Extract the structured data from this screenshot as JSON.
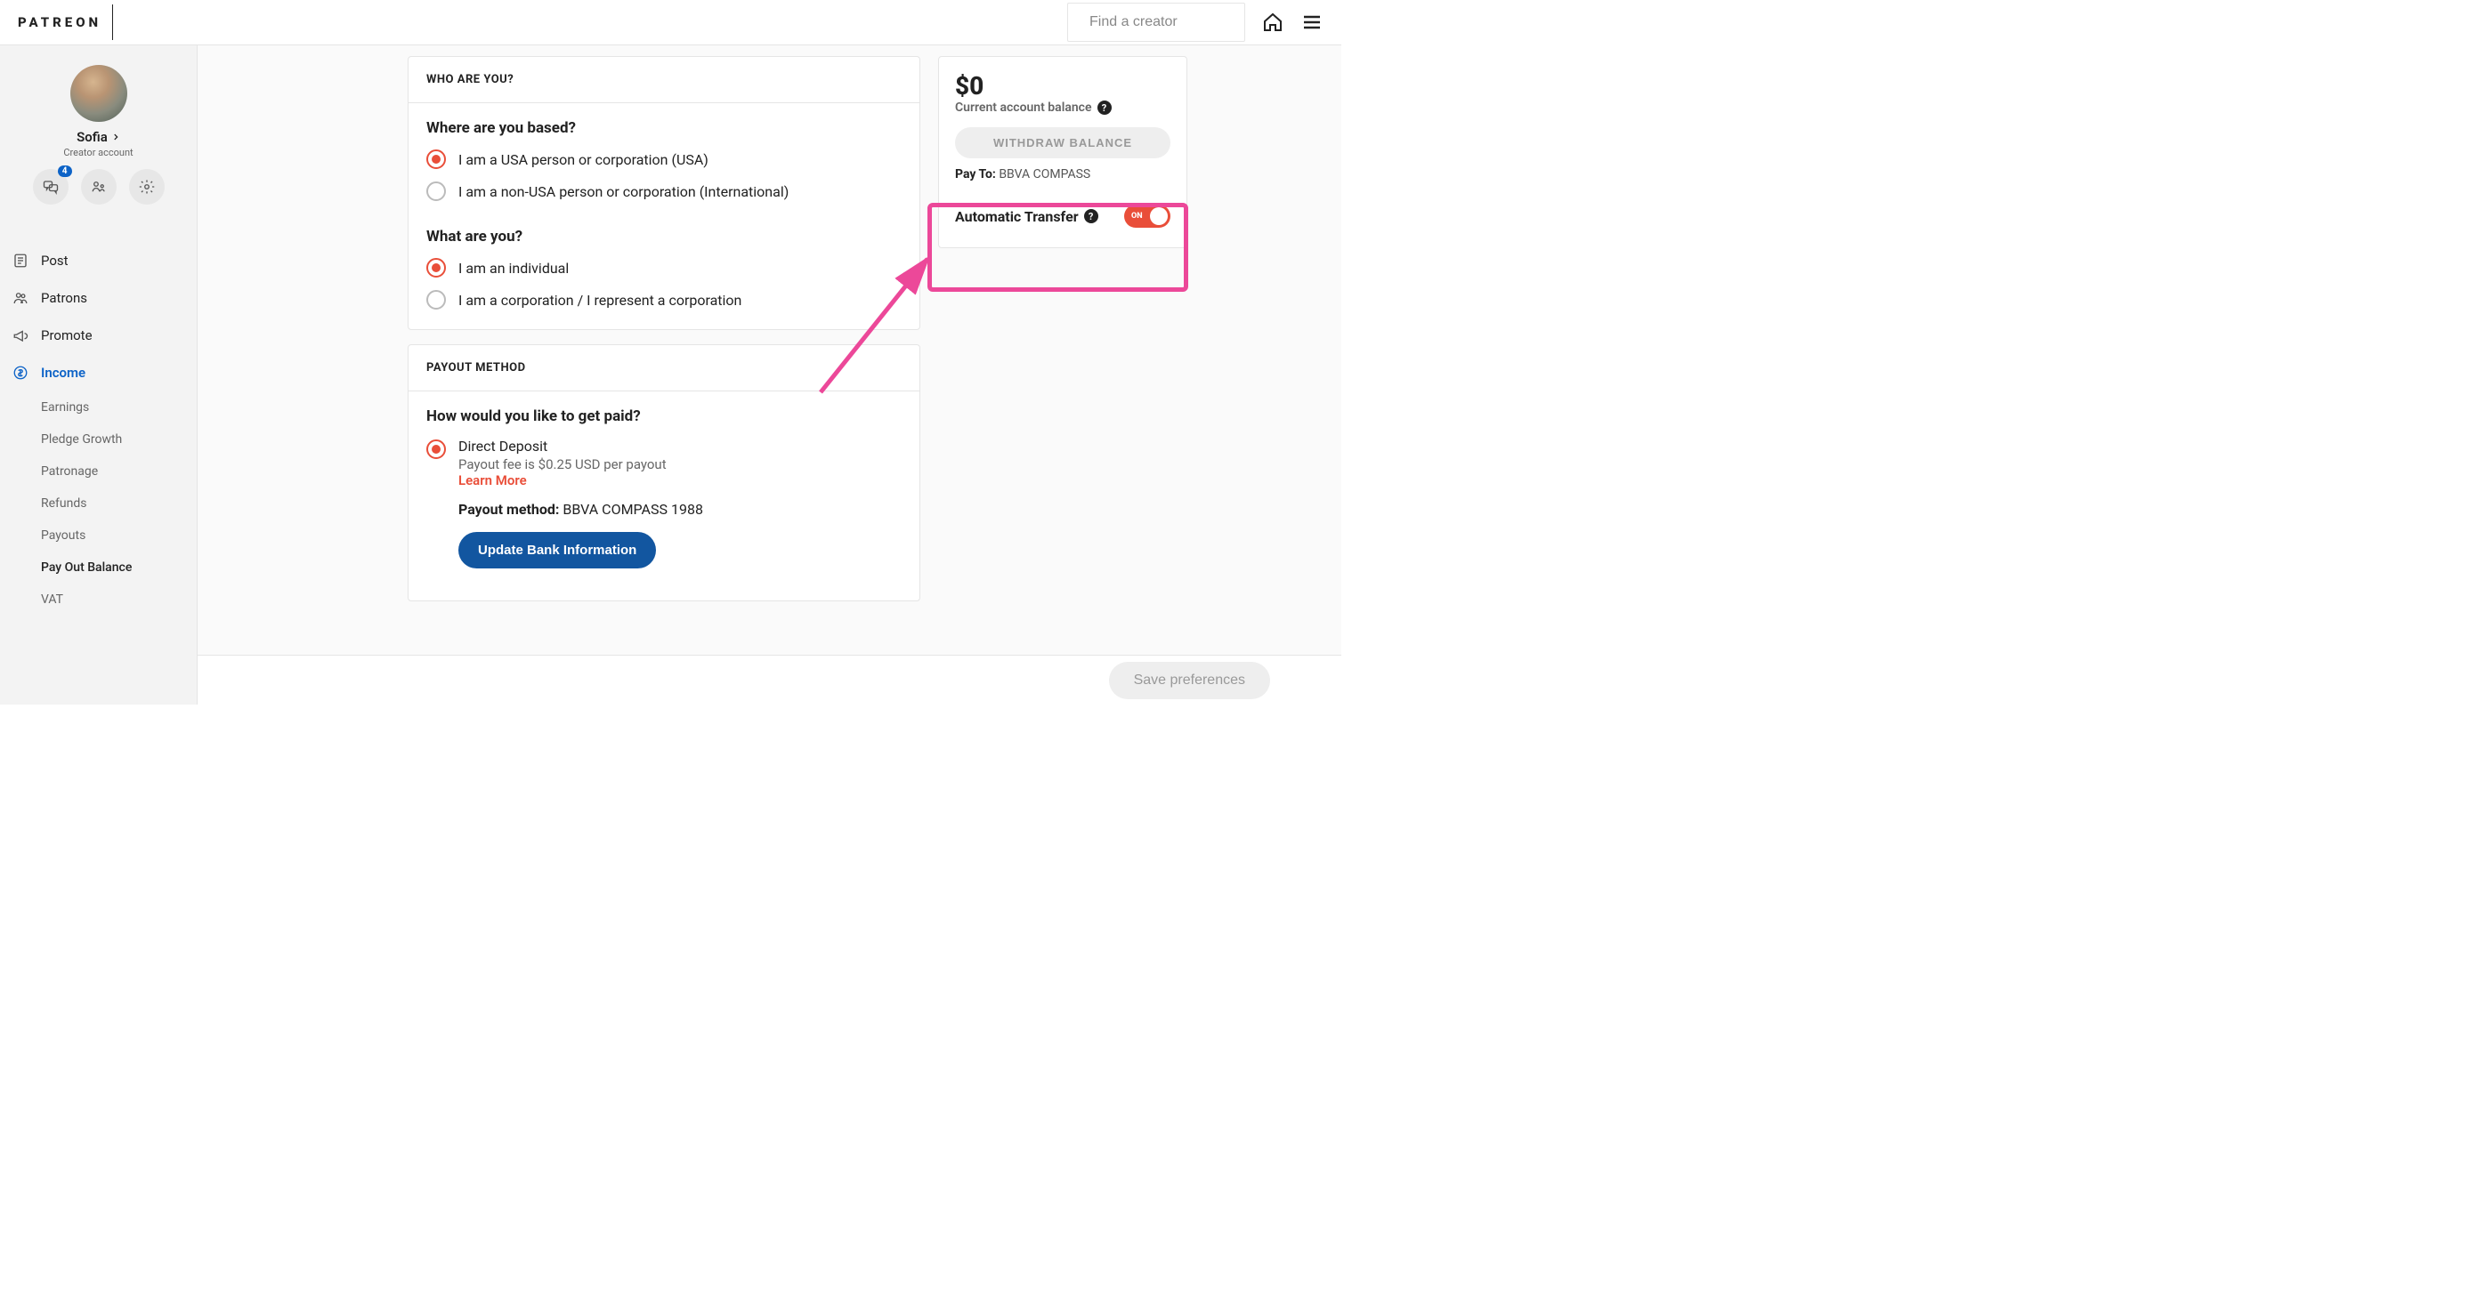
{
  "brand": "PATREON",
  "search": {
    "placeholder": "Find a creator"
  },
  "profile": {
    "name": "Sofia",
    "subtitle": "Creator account",
    "badge_count": "4"
  },
  "nav": {
    "post": "Post",
    "patrons": "Patrons",
    "promote": "Promote",
    "income": "Income"
  },
  "subnav": {
    "earnings": "Earnings",
    "pledge_growth": "Pledge Growth",
    "patronage": "Patronage",
    "refunds": "Refunds",
    "payouts": "Payouts",
    "pay_out_balance": "Pay Out Balance",
    "vat": "VAT"
  },
  "who_card": {
    "title": "WHO ARE YOU?",
    "q1": "Where are you based?",
    "opt1a": "I am a USA person or corporation (USA)",
    "opt1b": "I am a non-USA person or corporation (International)",
    "q2": "What are you?",
    "opt2a": "I am an individual",
    "opt2b": "I am a corporation / I represent a corporation"
  },
  "payout_card": {
    "title": "PAYOUT METHOD",
    "q": "How would you like to get paid?",
    "opt_label": "Direct Deposit",
    "opt_sub": "Payout fee is $0.25 USD per payout",
    "learn_more": "Learn More",
    "method_prefix": "Payout method:",
    "method_value": "BBVA COMPASS 1988",
    "update_btn": "Update Bank Information"
  },
  "balance": {
    "amount": "$0",
    "label": "Current account balance",
    "withdraw": "WITHDRAW BALANCE",
    "payto_prefix": "Pay To:",
    "payto_value": "BBVA COMPASS",
    "auto_label": "Automatic Transfer",
    "toggle_state": "ON"
  },
  "save_btn": "Save preferences"
}
